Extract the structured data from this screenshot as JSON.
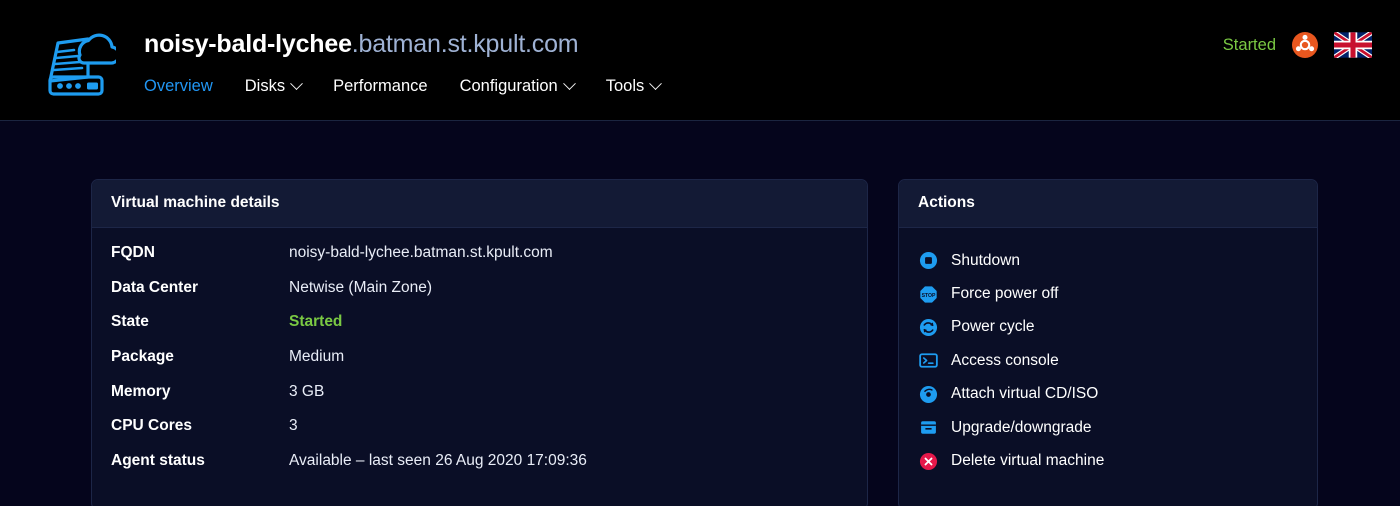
{
  "navbar": {
    "logo_icon": "server-cloud-icon",
    "title_host": "noisy-bald-lychee",
    "title_domain": ".batman.st.kpult.com",
    "tabs": [
      {
        "label": "Overview",
        "active": true,
        "caret": false,
        "name": "tab-overview"
      },
      {
        "label": "Disks",
        "active": false,
        "caret": true,
        "name": "tab-disks"
      },
      {
        "label": "Performance",
        "active": false,
        "caret": false,
        "name": "tab-performance"
      },
      {
        "label": "Configuration",
        "active": false,
        "caret": true,
        "name": "tab-configuration"
      },
      {
        "label": "Tools",
        "active": false,
        "caret": true,
        "name": "tab-tools"
      }
    ],
    "status_label": "Started",
    "os_icon": "ubuntu-logo-icon",
    "locale_icon": "uk-flag-icon"
  },
  "details": {
    "title": "Virtual machine details",
    "rows": [
      {
        "label": "FQDN",
        "value": "noisy-bald-lychee.batman.st.kpult.com"
      },
      {
        "label": "Data Center",
        "value": "Netwise (Main Zone)"
      },
      {
        "label": "State",
        "value": "Started"
      },
      {
        "label": "Package",
        "value": "Medium"
      },
      {
        "label": "Memory",
        "value": "3 GB"
      },
      {
        "label": "CPU Cores",
        "value": "3"
      },
      {
        "label": "Agent status",
        "value": "Available – last seen 26 Aug 2020 17:09:36"
      }
    ]
  },
  "actions": {
    "title": "Actions",
    "items": [
      {
        "label": "Shutdown",
        "icon": "power-stop-circle-icon",
        "name": "action-shutdown"
      },
      {
        "label": "Force power off",
        "icon": "stop-sign-icon",
        "name": "action-force-power-off"
      },
      {
        "label": "Power cycle",
        "icon": "refresh-circle-icon",
        "name": "action-power-cycle"
      },
      {
        "label": "Access console",
        "icon": "terminal-icon",
        "name": "action-access-console"
      },
      {
        "label": "Attach virtual CD/ISO",
        "icon": "disc-icon",
        "name": "action-attach-cd-iso"
      },
      {
        "label": "Upgrade/downgrade",
        "icon": "box-archive-icon",
        "name": "action-upgrade-downgrade"
      },
      {
        "label": "Delete virtual machine",
        "icon": "delete-x-circle-icon",
        "name": "action-delete-vm"
      }
    ]
  },
  "colors": {
    "accent_blue": "#2196f3",
    "status_green": "#7ac943",
    "danger_red": "#e6184a",
    "ubuntu_orange": "#e8571f",
    "panel_bg": "#0a0e26",
    "panel_header_bg": "#131a35",
    "page_bg": "#05051c",
    "navbar_bg": "#000000"
  }
}
